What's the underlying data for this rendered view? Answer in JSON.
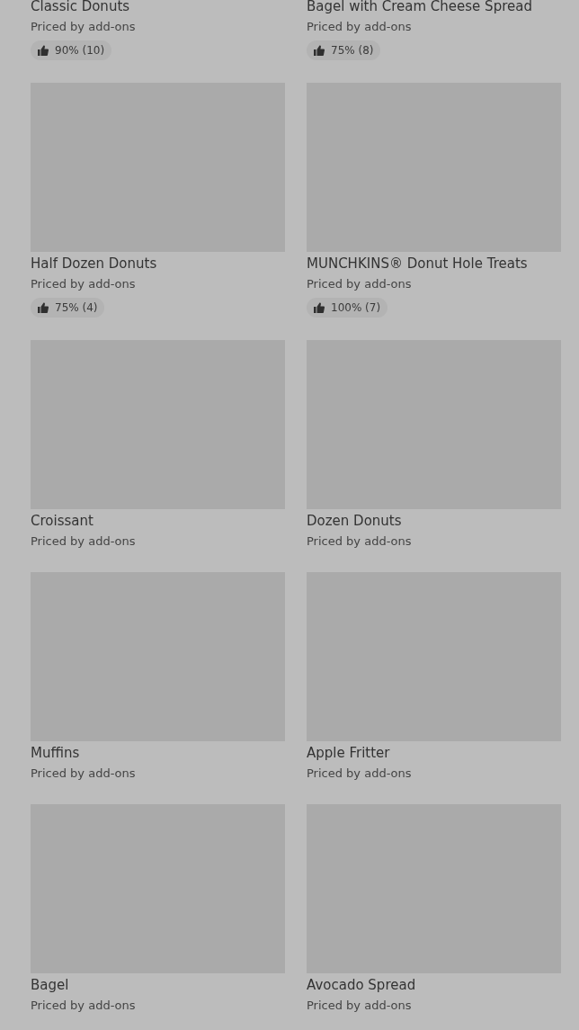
{
  "items": [
    {
      "photo": false,
      "title": "Classic Donuts",
      "price": "Priced by add-ons",
      "rating": "90% (10)"
    },
    {
      "photo": false,
      "title": "Bagel with Cream Cheese Spread",
      "price": "Priced by add-ons",
      "rating": "75% (8)"
    },
    {
      "photo": true,
      "title": "Half Dozen Donuts",
      "price": "Priced by add-ons",
      "rating": "75% (4)"
    },
    {
      "photo": true,
      "title": "MUNCHKINS® Donut Hole Treats",
      "price": "Priced by add-ons",
      "rating": "100% (7)"
    },
    {
      "photo": true,
      "title": "Croissant",
      "price": "Priced by add-ons"
    },
    {
      "photo": true,
      "title": "Dozen Donuts",
      "price": "Priced by add-ons"
    },
    {
      "photo": true,
      "title": "Muffins",
      "price": "Priced by add-ons"
    },
    {
      "photo": true,
      "title": "Apple Fritter",
      "price": "Priced by add-ons"
    },
    {
      "photo": true,
      "title": "Bagel",
      "price": "Priced by add-ons"
    },
    {
      "photo": true,
      "title": "Avocado Spread",
      "price": "Priced by add-ons"
    }
  ]
}
